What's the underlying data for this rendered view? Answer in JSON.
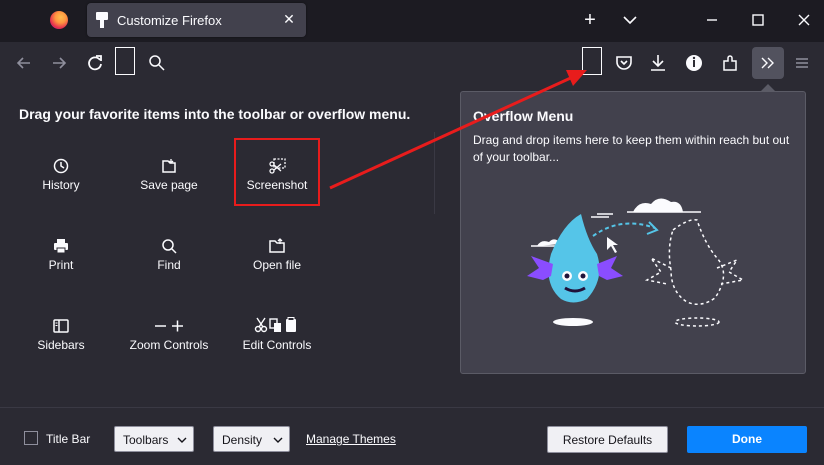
{
  "window": {
    "tab_title": "Customize Firefox",
    "icons": {
      "browser_logo": "firefox-logo-icon",
      "tab_icon": "customize-icon",
      "tab_close": "close-icon",
      "new_tab": "plus-icon",
      "list_tabs": "chevron-down-icon",
      "minimize": "minimize-icon",
      "maximize": "maximize-icon",
      "close": "close-icon"
    }
  },
  "toolbar": {
    "icons": [
      "back-icon",
      "forward-icon",
      "reload-icon",
      "search-icon",
      "pocket-icon",
      "download-icon",
      "account-icon",
      "extensions-icon",
      "overflow-chevron-icon",
      "hamburger-menu-icon"
    ]
  },
  "palette": {
    "title": "Drag your favorite items into the toolbar or overflow menu.",
    "items": [
      {
        "label": "History",
        "icon": "history-clock-icon"
      },
      {
        "label": "Save page",
        "icon": "save-page-icon"
      },
      {
        "label": "Screenshot",
        "icon": "screenshot-scissors-icon"
      },
      {
        "label": "Print",
        "icon": "printer-icon"
      },
      {
        "label": "Find",
        "icon": "magnifier-icon"
      },
      {
        "label": "Open file",
        "icon": "open-file-icon"
      },
      {
        "label": "Sidebars",
        "icon": "sidebar-icon"
      },
      {
        "label": "Zoom Controls",
        "icon": "zoom-controls-icon"
      },
      {
        "label": "Edit Controls",
        "icon": "edit-controls-icon"
      }
    ]
  },
  "overflow_panel": {
    "title": "Overflow Menu",
    "description": "Drag and drop items here to keep them within reach but out of your toolbar..."
  },
  "footer": {
    "title_bar_label": "Title Bar",
    "title_bar_checked": false,
    "toolbars_label": "Toolbars",
    "density_label": "Density",
    "manage_themes_label": "Manage Themes",
    "restore_defaults_label": "Restore Defaults",
    "done_label": "Done"
  },
  "colors": {
    "accent": "#0a84ff",
    "annotation_red": "#e81c1c",
    "background": "#2b2a33",
    "panel": "#42414d"
  }
}
